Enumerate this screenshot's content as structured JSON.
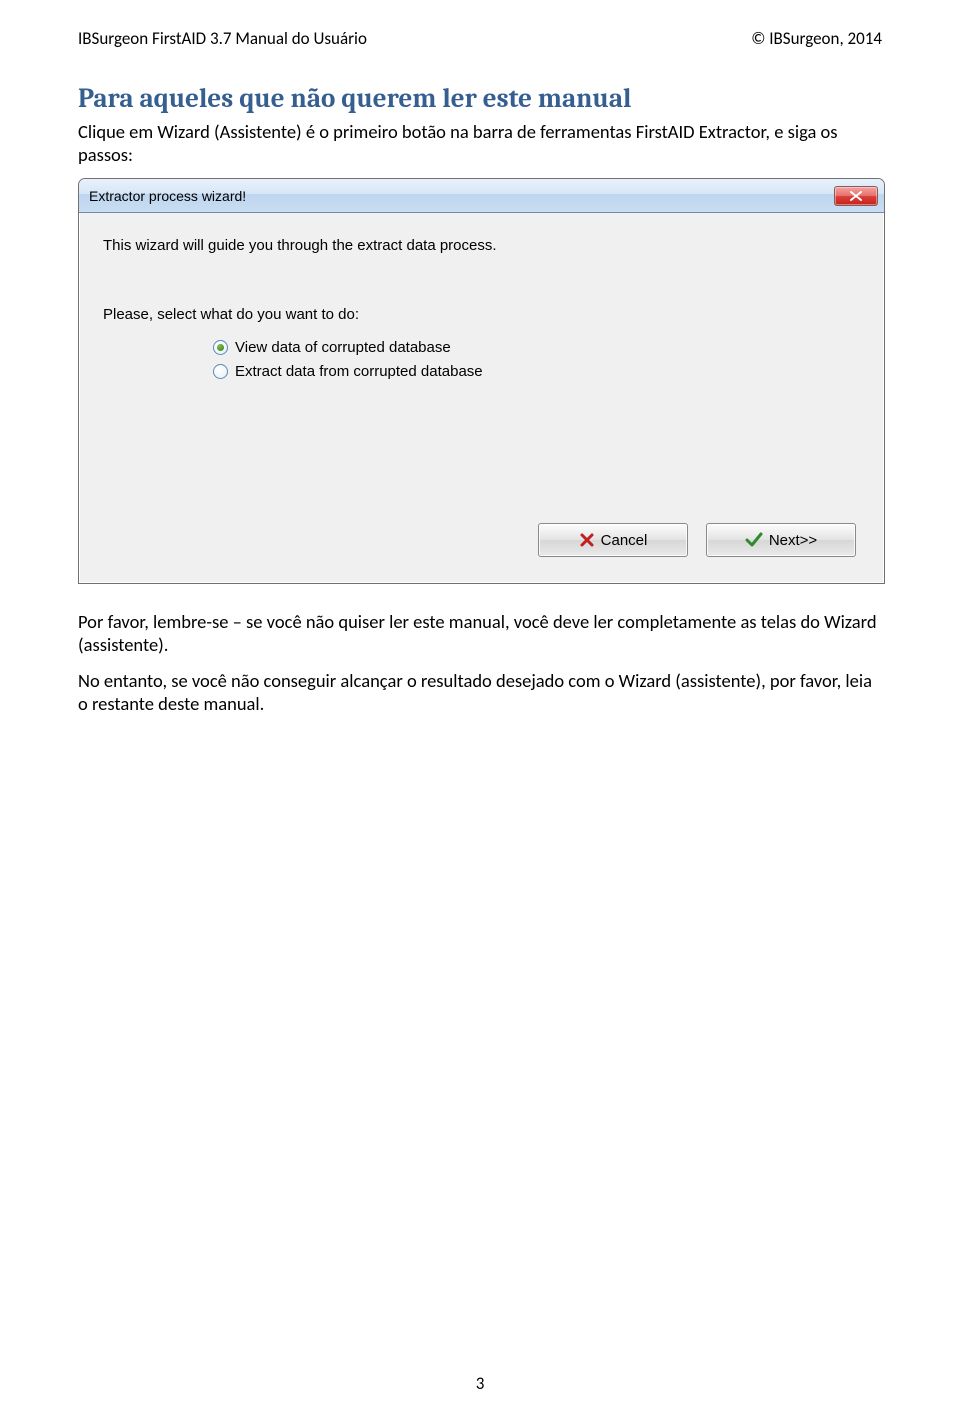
{
  "header": {
    "left": "IBSurgeon FirstAID 3.7 Manual do Usuário",
    "right": "© IBSurgeon, 2014"
  },
  "section": {
    "title": "Para aqueles que não querem ler este manual",
    "p1": "Clique em Wizard (Assistente) é o primeiro botão na barra de ferramentas FirstAID Extractor, e siga os passos:",
    "p2": "Por favor, lembre-se – se você não quiser ler este manual, você deve ler completamente as telas do Wizard (assistente).",
    "p3": "No entanto, se você não conseguir alcançar o resultado desejado com o Wizard (assistente), por favor, leia o restante deste manual."
  },
  "dialog": {
    "title": "Extractor process wizard!",
    "intro": "This wizard will guide you through the extract data process.",
    "prompt": "Please, select what do you want to do:",
    "option_view": "View data of corrupted database",
    "option_extract": "Extract data from corrupted database",
    "cancel": "Cancel",
    "next": "Next>>"
  },
  "page_number": "3"
}
